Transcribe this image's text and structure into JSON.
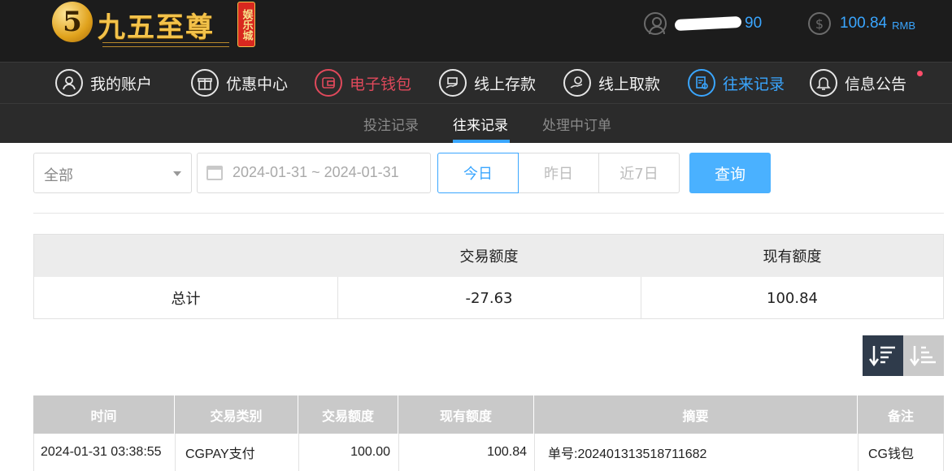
{
  "header": {
    "logo_mark": "5",
    "logo_text": "九五至尊",
    "logo_badge": "娱乐城",
    "username_visible": "90",
    "balance": "100.84",
    "currency": "RMB"
  },
  "nav": {
    "items": [
      {
        "label": "我的账户",
        "icon": "user-icon"
      },
      {
        "label": "优惠中心",
        "icon": "gift-icon"
      },
      {
        "label": "电子钱包",
        "icon": "wallet-icon"
      },
      {
        "label": "线上存款",
        "icon": "deposit-icon"
      },
      {
        "label": "线上取款",
        "icon": "withdraw-icon"
      },
      {
        "label": "往来记录",
        "icon": "records-icon"
      },
      {
        "label": "信息公告",
        "icon": "bell-icon"
      }
    ]
  },
  "subtabs": [
    "投注记录",
    "往来记录",
    "处理中订单"
  ],
  "filters": {
    "type_select": "全部",
    "date_range": "2024-01-31 ~ 2024-01-31",
    "quick_today": "今日",
    "quick_yesterday": "昨日",
    "quick_week": "近7日",
    "search": "查询"
  },
  "summary": {
    "col_amount": "交易额度",
    "col_balance": "现有额度",
    "row_label": "总计",
    "amount": "-27.63",
    "balance": "100.84"
  },
  "records": {
    "columns": [
      "时间",
      "交易类别",
      "交易额度",
      "现有额度",
      "摘要",
      "备注"
    ],
    "rows": [
      [
        "2024-01-31 03:38:55",
        "CGPAY支付",
        "100.00",
        "100.84",
        "单号:20240131351871168​2",
        "CG钱包"
      ]
    ]
  },
  "colors": {
    "accent": "#3aa6ff",
    "wallet_red": "#e0495b",
    "header_bg": "#1c1c1c",
    "nav_bg": "#2b2b2b"
  }
}
